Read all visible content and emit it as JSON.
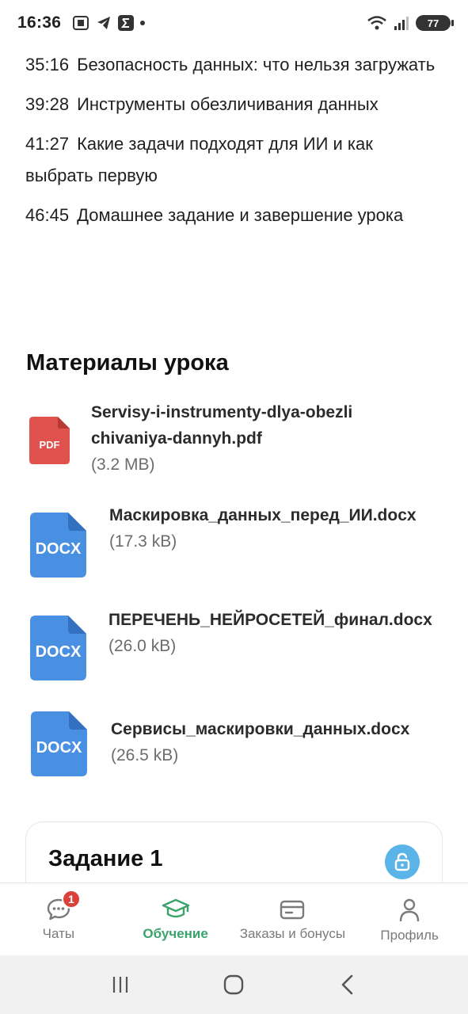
{
  "status_bar": {
    "time": "16:36",
    "battery": "77"
  },
  "timecodes": [
    {
      "time": "35:16",
      "title": "Безопасность данных: что нельзя загружать"
    },
    {
      "time": "39:28",
      "title": "Инструменты обезличивания данных"
    },
    {
      "time": "41:27",
      "title": "Какие задачи подходят для ИИ и как выбрать первую"
    },
    {
      "time": "46:45",
      "title": "Домашнее задание и завершение урока"
    }
  ],
  "materials": {
    "title": "Материалы урока",
    "files": [
      {
        "name": "Servisy-i-instrumenty-dlya-obezlichivaniya-dannyh.pdf",
        "size": "(3.2 MB)",
        "type": "PDF",
        "icon": "pdf-file-icon",
        "color": "#e0524d"
      },
      {
        "name": "Маскировка_данных_перед_ИИ.docx",
        "size": "(17.3 kB)",
        "type": "DOCX",
        "icon": "docx-file-icon",
        "color": "#4a90e2"
      },
      {
        "name": "ПЕРЕЧЕНЬ_НЕЙРОСЕТЕЙ_финал.docx",
        "size": "(26.0 kB)",
        "type": "DOCX",
        "icon": "docx-file-icon",
        "color": "#4a90e2"
      },
      {
        "name": "Сервисы_маскировки_данных.docx",
        "size": "(26.5 kB)",
        "type": "DOCX",
        "icon": "docx-file-icon",
        "color": "#4a90e2"
      }
    ]
  },
  "task": {
    "title": "Задание 1",
    "icon": "unlock-icon"
  },
  "bottom_nav": {
    "items": [
      {
        "label": "Чаты",
        "icon": "chat-icon",
        "badge": "1"
      },
      {
        "label": "Обучение",
        "icon": "graduation-cap-icon",
        "active": true
      },
      {
        "label": "Заказы и бонусы",
        "icon": "card-icon"
      },
      {
        "label": "Профиль",
        "icon": "profile-icon"
      }
    ]
  },
  "colors": {
    "accent_green": "#3aa36b",
    "pdf_red": "#e0524d",
    "docx_blue": "#4a90e2",
    "lock_blue": "#5ab4e8",
    "badge_red": "#d9413a"
  }
}
